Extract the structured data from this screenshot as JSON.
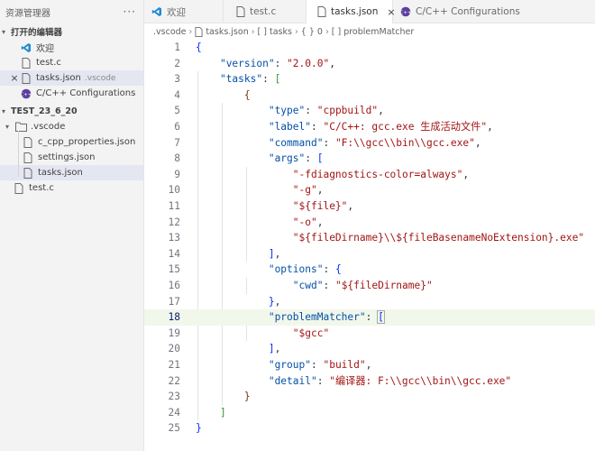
{
  "sidebar": {
    "title": "资源管理器",
    "more": "···",
    "open_editors_title": "打开的编辑器",
    "open_editors": [
      {
        "label": "欢迎",
        "desc": "",
        "icon": "vscode-logo-icon"
      },
      {
        "label": "test.c",
        "desc": "",
        "icon": "file-icon"
      },
      {
        "label": "tasks.json",
        "desc": ".vscode",
        "icon": "file-icon"
      },
      {
        "label": "C/C++ Configurations",
        "desc": "",
        "icon": "cpp-config-icon"
      }
    ],
    "workspace_title": "TEST_23_6_20",
    "tree": {
      "folder": ".vscode",
      "children": [
        "c_cpp_properties.json",
        "settings.json",
        "tasks.json"
      ],
      "root_files": [
        "test.c"
      ]
    }
  },
  "tabs": [
    {
      "label": "欢迎"
    },
    {
      "label": "test.c"
    },
    {
      "label": "tasks.json",
      "close": "×"
    },
    {
      "label": "C/C++ Configurations"
    }
  ],
  "breadcrumb": [
    ".vscode",
    "tasks.json",
    "[ ] tasks",
    "{ } 0",
    "[ ] problemMatcher"
  ],
  "code_lines": [
    {
      "n": "1",
      "text": "{"
    },
    {
      "n": "2",
      "text": "    \"version\": \"2.0.0\","
    },
    {
      "n": "3",
      "text": "    \"tasks\": ["
    },
    {
      "n": "4",
      "text": "        {"
    },
    {
      "n": "5",
      "text": "            \"type\": \"cppbuild\","
    },
    {
      "n": "6",
      "text": "            \"label\": \"C/C++: gcc.exe 生成活动文件\","
    },
    {
      "n": "7",
      "text": "            \"command\": \"F:\\\\gcc\\\\bin\\\\gcc.exe\","
    },
    {
      "n": "8",
      "text": "            \"args\": ["
    },
    {
      "n": "9",
      "text": "                \"-fdiagnostics-color=always\","
    },
    {
      "n": "10",
      "text": "                \"-g\","
    },
    {
      "n": "11",
      "text": "                \"${file}\","
    },
    {
      "n": "12",
      "text": "                \"-o\","
    },
    {
      "n": "13",
      "text": "                \"${fileDirname}\\\\${fileBasenameNoExtension}.exe\""
    },
    {
      "n": "14",
      "text": "            ],"
    },
    {
      "n": "15",
      "text": "            \"options\": {"
    },
    {
      "n": "16",
      "text": "                \"cwd\": \"${fileDirname}\""
    },
    {
      "n": "17",
      "text": "            },"
    },
    {
      "n": "18",
      "text": "            \"problemMatcher\": ["
    },
    {
      "n": "19",
      "text": "                \"$gcc\""
    },
    {
      "n": "20",
      "text": "            ],"
    },
    {
      "n": "21",
      "text": "            \"group\": \"build\","
    },
    {
      "n": "22",
      "text": "            \"detail\": \"编译器: F:\\\\gcc\\\\bin\\\\gcc.exe\""
    },
    {
      "n": "23",
      "text": "        }"
    },
    {
      "n": "24",
      "text": "    ]"
    },
    {
      "n": "25",
      "text": "}"
    }
  ],
  "current_line": "18",
  "colors": {
    "key": "#0451a5",
    "string": "#a31515",
    "accent": "#007acc"
  }
}
